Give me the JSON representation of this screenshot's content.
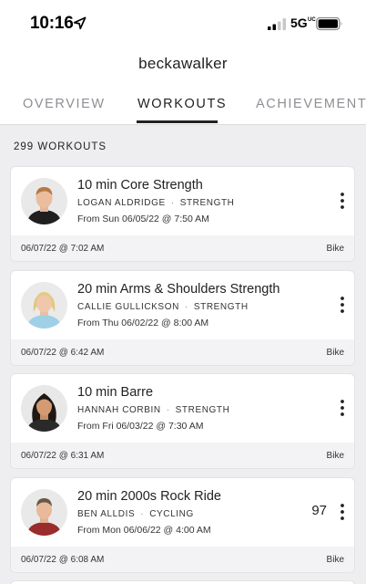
{
  "status_bar": {
    "time": "10:16",
    "network": "5G",
    "network_sub": "UC"
  },
  "profile": {
    "username": "beckawalker"
  },
  "tabs": [
    {
      "label": "OVERVIEW",
      "active": false
    },
    {
      "label": "WORKOUTS",
      "active": true
    },
    {
      "label": "ACHIEVEMENTS",
      "active": false
    }
  ],
  "workouts": {
    "count_label": "299 WORKOUTS",
    "items": [
      {
        "title": "10 min Core Strength",
        "instructor": "LOGAN ALDRIDGE",
        "category": "STRENGTH",
        "from": "From Sun 06/05/22 @ 7:50 AM",
        "taken": "06/07/22 @ 7:02 AM",
        "equipment": "Bike",
        "output": ""
      },
      {
        "title": "20 min Arms & Shoulders Strength",
        "instructor": "CALLIE GULLICKSON",
        "category": "STRENGTH",
        "from": "From Thu 06/02/22 @ 8:00 AM",
        "taken": "06/07/22 @ 6:42 AM",
        "equipment": "Bike",
        "output": ""
      },
      {
        "title": "10 min Barre",
        "instructor": "HANNAH CORBIN",
        "category": "STRENGTH",
        "from": "From Fri 06/03/22 @ 7:30 AM",
        "taken": "06/07/22 @ 6:31 AM",
        "equipment": "Bike",
        "output": ""
      },
      {
        "title": "20 min 2000s Rock Ride",
        "instructor": "BEN ALLDIS",
        "category": "CYCLING",
        "from": "From Mon 06/06/22 @ 4:00 AM",
        "taken": "06/07/22 @ 6:08 AM",
        "equipment": "Bike",
        "output": "97"
      }
    ]
  },
  "colors": {
    "background": "#ffffff",
    "list_background": "#eeeef0",
    "card_footer": "#f3f3f5",
    "active_tab": "#222222",
    "inactive_tab": "#8d8f94"
  }
}
